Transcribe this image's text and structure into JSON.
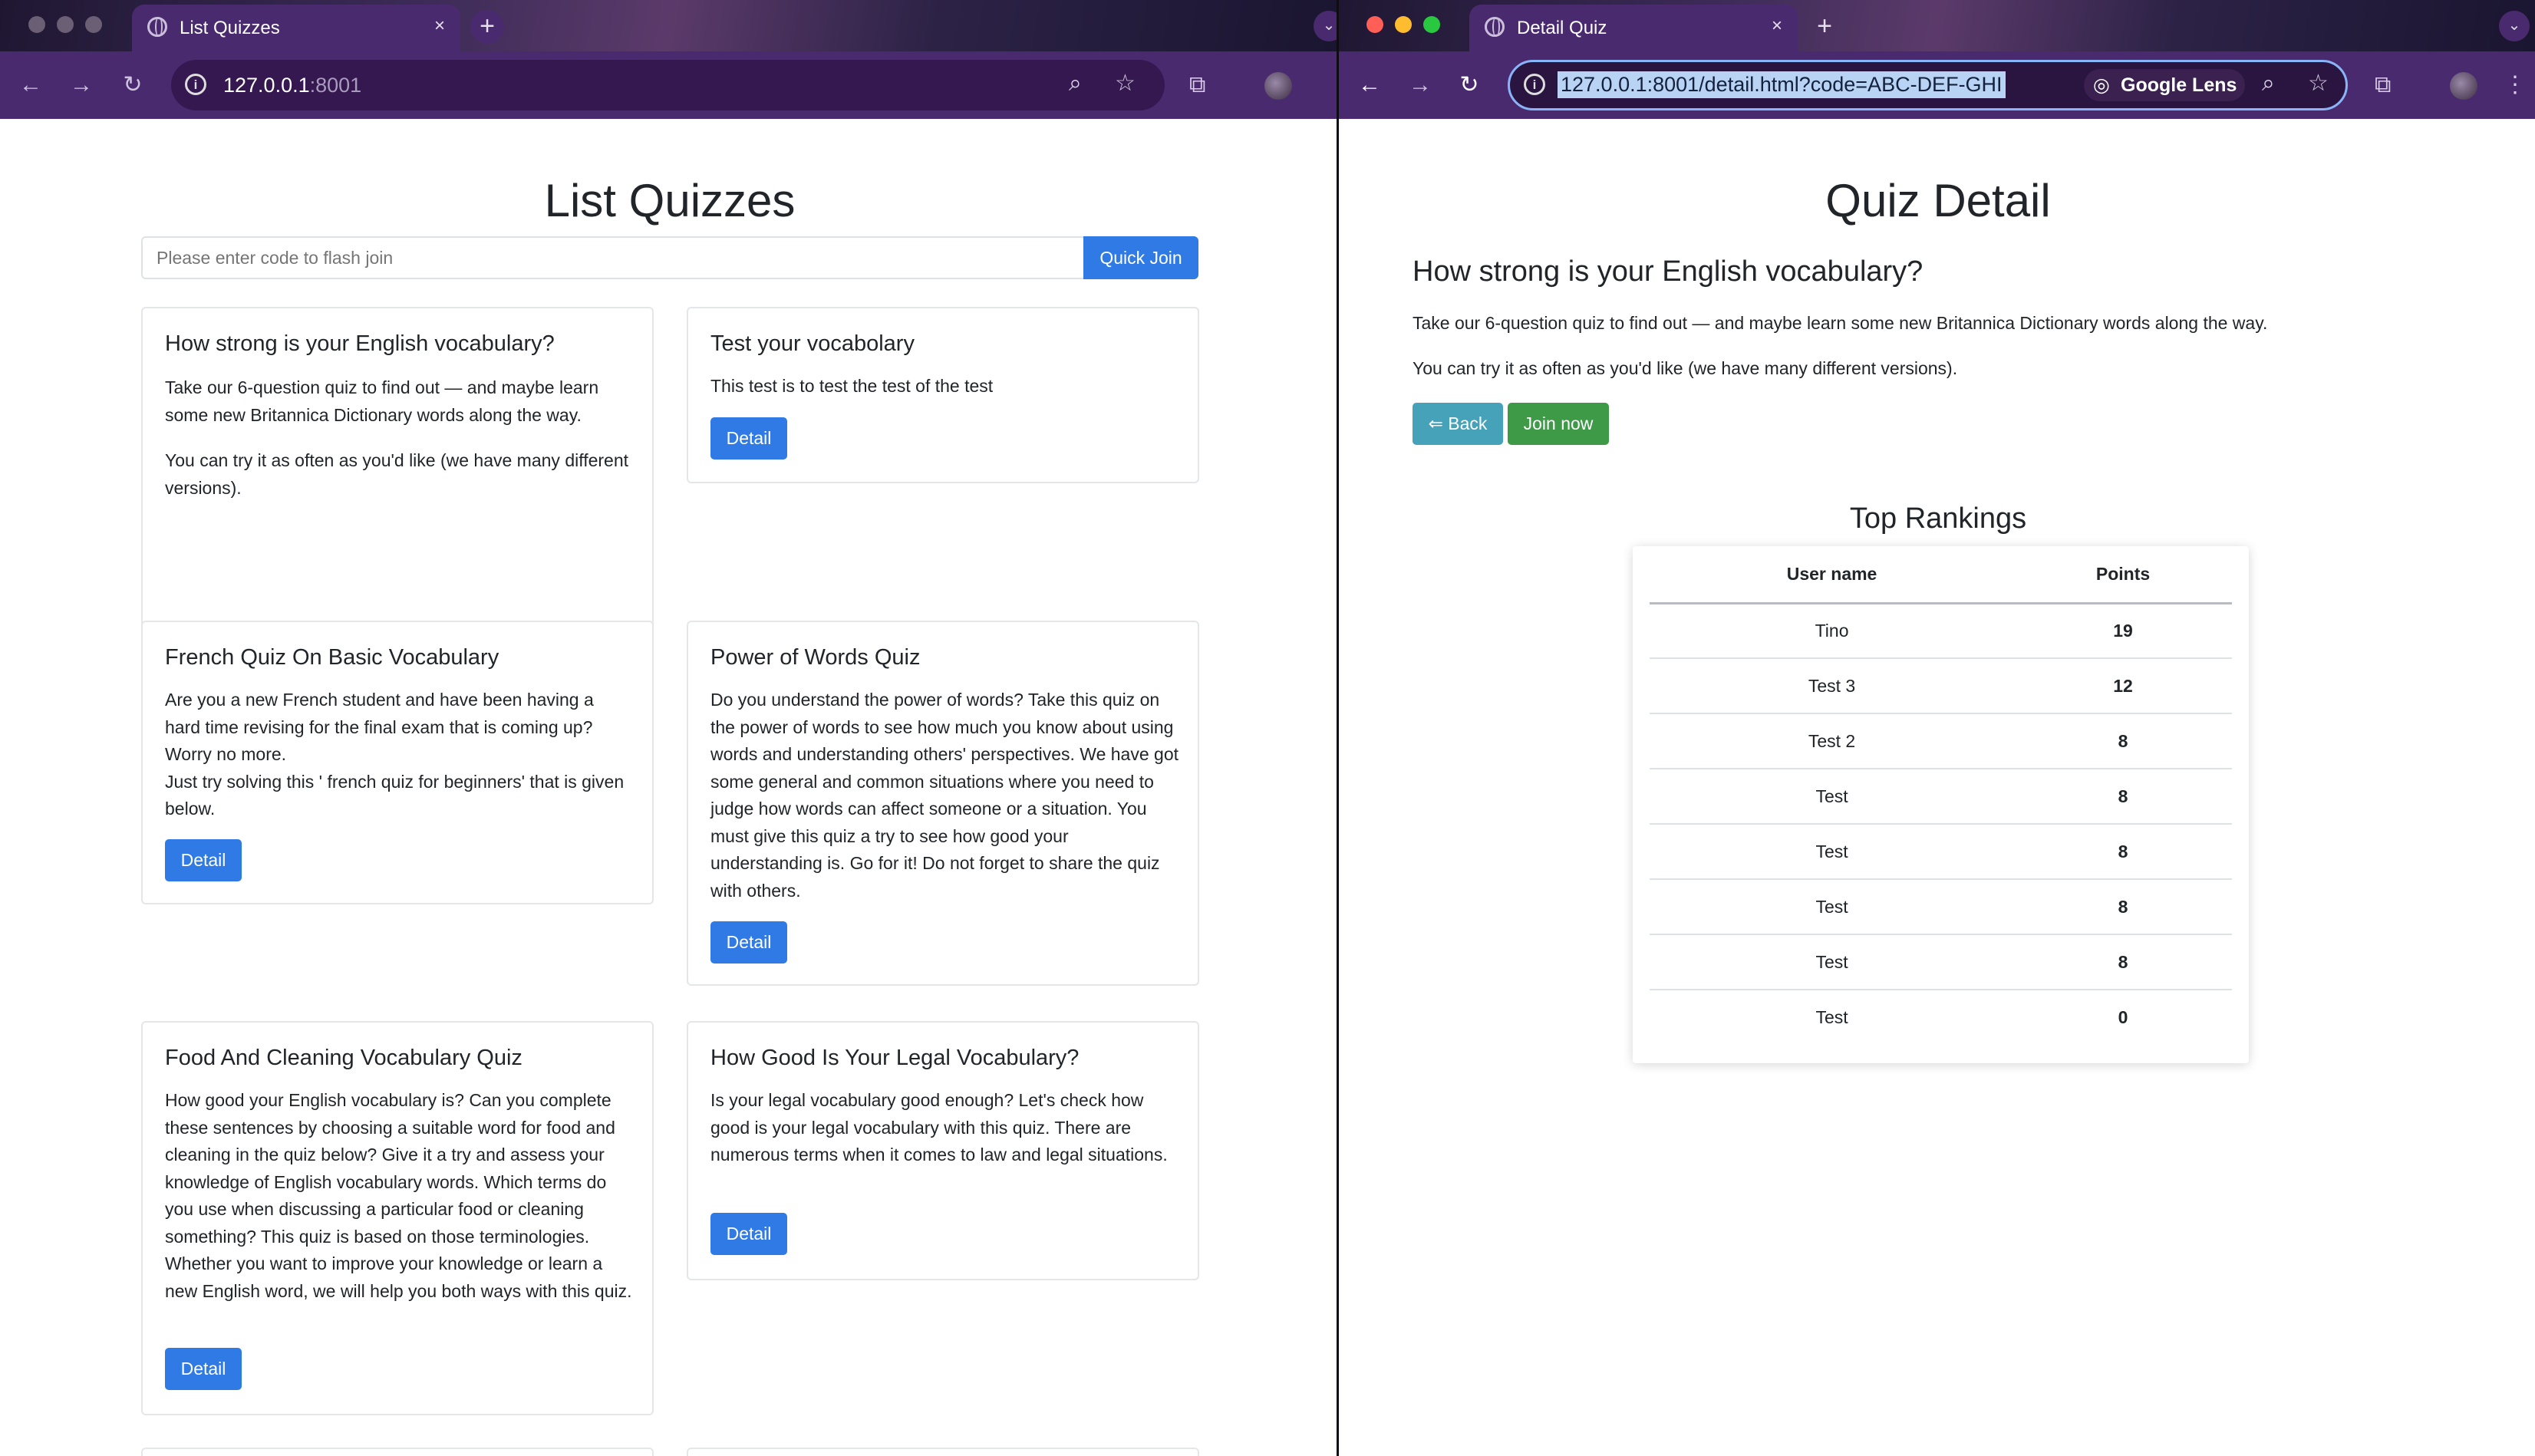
{
  "left_window": {
    "tab_title": "List Quizzes",
    "close": "×",
    "new_tab": "+",
    "url_host": "127.0.0.1",
    "url_port": ":8001",
    "page": {
      "heading": "List Quizzes",
      "search_placeholder": "Please enter code to flash join",
      "quick_join_label": "Quick Join",
      "detail_label": "Detail",
      "cards": [
        {
          "title": "How strong is your English vocabulary?",
          "p1": "Take our 6-question quiz to find out — and maybe learn some new Britannica Dictionary words along the way.",
          "p2": "You can try it as often as you'd like (we have many different versions)."
        },
        {
          "title": "Test your vocabolary",
          "p1": "This test is to test the test of the test"
        },
        {
          "title": "French Quiz On Basic Vocabulary",
          "p1": "Are you a new French student and have been having a hard time revising for the final exam that is coming up? Worry no more.",
          "p2": "Just try solving this ' french quiz for beginners' that is given below."
        },
        {
          "title": "Power of Words Quiz",
          "p1": "Do you understand the power of words? Take this quiz on the power of words to see how much you know about using words and understanding others' perspectives. We have got some general and common situations where you need to judge how words can affect someone or a situation. You must give this quiz a try to see how good your understanding is. Go for it! Do not forget to share the quiz with others."
        },
        {
          "title": "Food And Cleaning Vocabulary Quiz",
          "p1": "How good your English vocabulary is? Can you complete these sentences by choosing a suitable word for food and cleaning in the quiz below? Give it a try and assess your knowledge of English vocabulary words. Which terms do you use when discussing a particular food or cleaning something? This quiz is based on those terminologies. Whether you want to improve your knowledge or learn a new English word, we will help you both ways with this quiz."
        },
        {
          "title": "How Good Is Your Legal Vocabulary?",
          "p1": "Is your legal vocabulary good enough? Let's check how good is your legal vocabulary with this quiz. There are numerous terms when it comes to law and legal situations."
        }
      ]
    }
  },
  "right_window": {
    "tab_title": "Detail Quiz",
    "close": "×",
    "new_tab": "+",
    "url": "127.0.0.1:8001/detail.html?code=ABC-DEF-GHI",
    "google_lens": "Google Lens",
    "page": {
      "heading": "Quiz Detail",
      "quiz_title": "How strong is your English vocabulary?",
      "desc1": "Take our 6-question quiz to find out — and maybe learn some new Britannica Dictionary words along the way.",
      "desc2": "You can try it as often as you'd like (we have many different versions).",
      "back_label": "⇐ Back",
      "join_label": "Join now",
      "rankings_title": "Top Rankings",
      "col_user": "User name",
      "col_points": "Points",
      "rows": [
        {
          "user": "Tino",
          "points": "19"
        },
        {
          "user": "Test 3",
          "points": "12"
        },
        {
          "user": "Test 2",
          "points": "8"
        },
        {
          "user": "Test",
          "points": "8"
        },
        {
          "user": "Test",
          "points": "8"
        },
        {
          "user": "Test",
          "points": "8"
        },
        {
          "user": "Test",
          "points": "8"
        },
        {
          "user": "Test",
          "points": "0"
        }
      ]
    }
  },
  "colors": {
    "primary": "#2f7ae5",
    "info": "#46a2b8",
    "success": "#3f9a48",
    "chrome_toolbar": "#4a2a6e"
  }
}
